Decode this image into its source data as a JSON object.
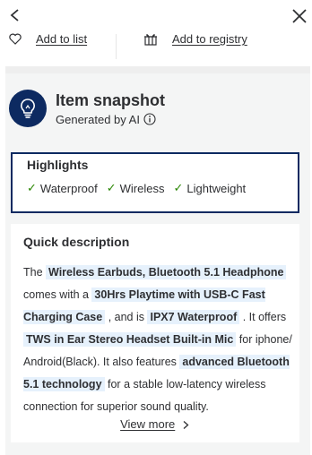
{
  "actions": {
    "add_to_list": "Add to list",
    "add_to_registry": "Add to registry"
  },
  "snapshot": {
    "title": "Item snapshot",
    "subtitle": "Generated by AI"
  },
  "highlights": {
    "title": "Highlights",
    "items": [
      "Waterproof",
      "Wireless",
      "Lightweight"
    ]
  },
  "quick_description": {
    "title": "Quick description",
    "segments": [
      {
        "text": "The ",
        "bold": false
      },
      {
        "text": "Wireless Earbuds, Bluetooth 5.1 Headphone",
        "bold": true
      },
      {
        "text": " comes with a ",
        "bold": false
      },
      {
        "text": "30Hrs Playtime with USB-C Fast Charging Case",
        "bold": true
      },
      {
        "text": " , and is ",
        "bold": false
      },
      {
        "text": "IPX7 Waterproof",
        "bold": true
      },
      {
        "text": " . It offers ",
        "bold": false
      },
      {
        "text": "TWS in Ear Stereo Headset Built-in Mic",
        "bold": true
      },
      {
        "text": " for iphone/ Android(Black). It also features ",
        "bold": false
      },
      {
        "text": "advanced Bluetooth 5.1 technology",
        "bold": true
      },
      {
        "text": " for a stable low-latency wireless connection for superior sound quality.",
        "bold": false
      }
    ],
    "view_more": "View more"
  },
  "colors": {
    "accent_navy": "#0d2a61",
    "check_green": "#2a8703",
    "highlight_bg": "#e6f1fc"
  },
  "icons": [
    "back-chevron-icon",
    "close-icon",
    "heart-icon",
    "gift-icon",
    "lightbulb-icon",
    "info-icon",
    "check-icon",
    "chevron-right-icon"
  ]
}
